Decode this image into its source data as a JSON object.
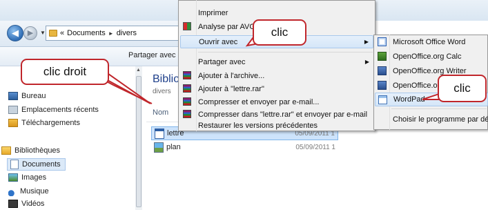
{
  "explorer": {
    "address": {
      "prefix": "«",
      "crumbs": [
        "Documents",
        "divers"
      ]
    },
    "toolbar": {
      "share_label": "Partager avec"
    },
    "sidebar": {
      "items": [
        {
          "label": "Bureau",
          "icon": "desktop-icon"
        },
        {
          "label": "Emplacements récents",
          "icon": "recent-places-icon"
        },
        {
          "label": "Téléchargements",
          "icon": "downloads-icon"
        },
        {
          "label": "Bibliothèques",
          "icon": "libraries-icon"
        },
        {
          "label": "Documents",
          "icon": "documents-icon",
          "selected": true
        },
        {
          "label": "Images",
          "icon": "images-icon"
        },
        {
          "label": "Musique",
          "icon": "music-icon"
        },
        {
          "label": "Vidéos",
          "icon": "videos-icon"
        }
      ]
    },
    "library": {
      "title": "Biblio",
      "subtitle": "divers",
      "column_name": "Nom"
    },
    "files": [
      {
        "name": "lettre",
        "date": "05/09/2011 1",
        "icon": "document-icon",
        "selected": true
      },
      {
        "name": "plan",
        "date": "05/09/2011 1",
        "icon": "image-file-icon",
        "selected": false
      }
    ]
  },
  "context_menu": {
    "items": [
      {
        "label": "Imprimer"
      },
      {
        "label": "Analyse par AVG",
        "icon": "avg-icon"
      },
      {
        "label": "Ouvrir avec",
        "has_submenu": true,
        "highlighted": true
      },
      {
        "label": "Partager avec",
        "has_submenu": true
      },
      {
        "label": "Ajouter à l'archive...",
        "icon": "winrar-icon"
      },
      {
        "label": "Ajouter à \"lettre.rar\"",
        "icon": "winrar-icon"
      },
      {
        "label": "Compresser et envoyer par e-mail...",
        "icon": "winrar-icon"
      },
      {
        "label": "Compresser dans \"lettre.rar\" et envoyer par e-mail",
        "icon": "winrar-icon"
      },
      {
        "label": "Restaurer les versions précédentes"
      }
    ]
  },
  "open_with_submenu": {
    "items": [
      {
        "label": "Microsoft Office Word",
        "icon": "word-icon"
      },
      {
        "label": "OpenOffice.org Calc",
        "icon": "oo-calc-icon"
      },
      {
        "label": "OpenOffice.org Writer",
        "icon": "oo-writer-icon"
      },
      {
        "label": "OpenOffice.org",
        "icon": "oo-writer-icon"
      },
      {
        "label": "WordPad",
        "icon": "wordpad-icon",
        "highlighted": true
      }
    ],
    "choose_default": "Choisir le programme par défaut..."
  },
  "callouts": {
    "right_click": "clic droit",
    "click_open_with": "clic",
    "click_wordpad": "clic",
    "border_color": "#c0262b"
  },
  "colors": {
    "menu_highlight": "#d5e6f8",
    "selection": "#cde3fb",
    "library_title": "#1e3f8a"
  }
}
